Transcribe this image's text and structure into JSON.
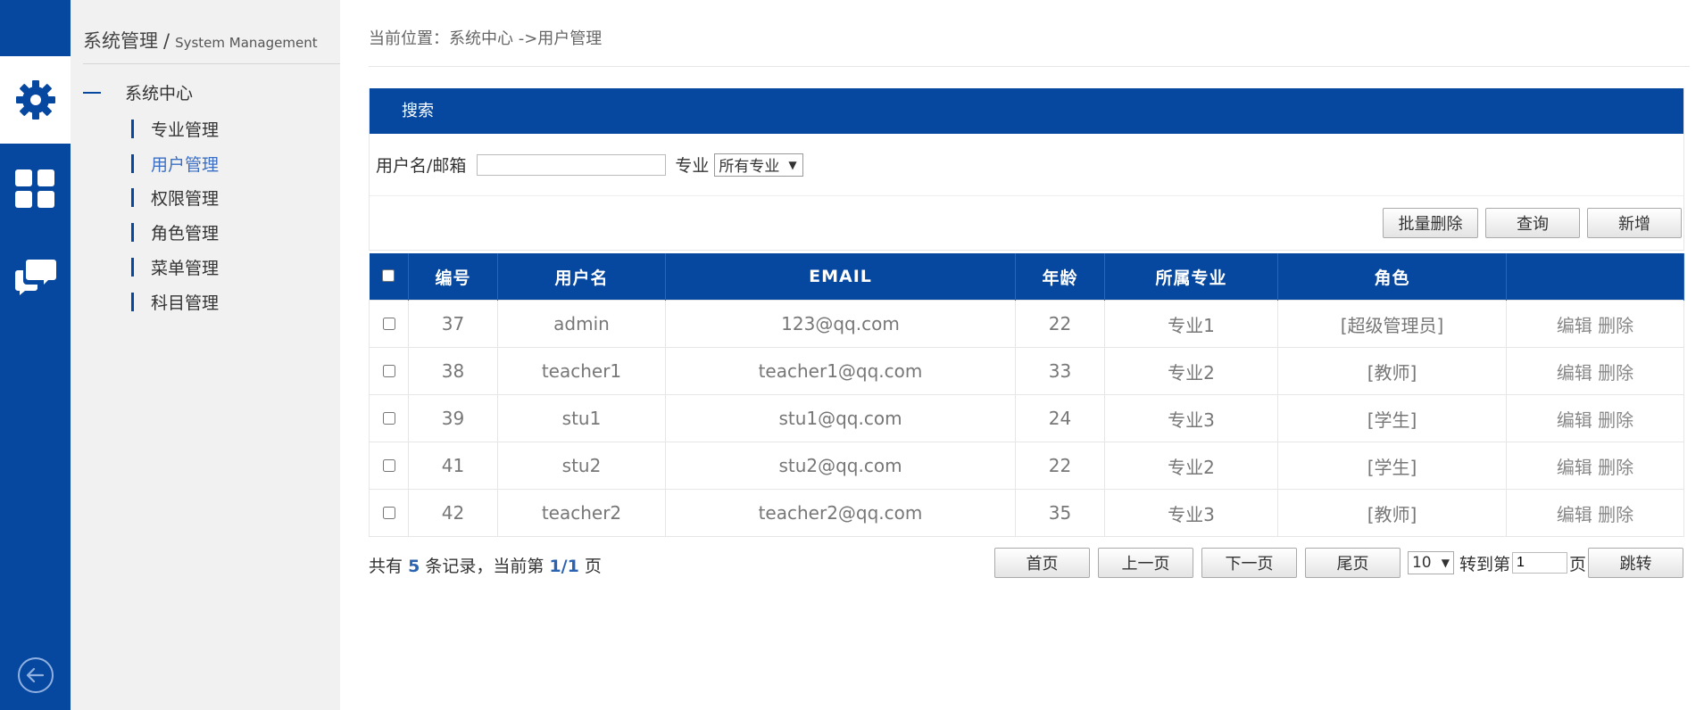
{
  "rail": {
    "items": [
      {
        "icon": "gear-icon",
        "active": true
      },
      {
        "icon": "grid-icon",
        "active": false
      },
      {
        "icon": "chat-icon",
        "active": false
      }
    ],
    "back_icon": "arrow-left-circle-icon"
  },
  "sidebar": {
    "title": "系统管理",
    "title_sep": "/",
    "title_en": "System Management",
    "group": "系统中心",
    "items": [
      {
        "label": "专业管理"
      },
      {
        "label": "用户管理",
        "active": true
      },
      {
        "label": "权限管理"
      },
      {
        "label": "角色管理"
      },
      {
        "label": "菜单管理"
      },
      {
        "label": "科目管理"
      }
    ]
  },
  "breadcrumb": "当前位置：系统中心 ->用户管理",
  "search": {
    "title": "搜索",
    "username_label": "用户名/邮箱",
    "username_value": "",
    "major_label": "专业",
    "major_selected": "所有专业"
  },
  "actions": {
    "batch_delete": "批量删除",
    "query": "查询",
    "add": "新增"
  },
  "table": {
    "headers": [
      "编号",
      "用户名",
      "EMAIL",
      "年龄",
      "所属专业",
      "角色",
      ""
    ],
    "rows": [
      {
        "id": "37",
        "username": "admin",
        "email": "123@qq.com",
        "age": "22",
        "major": "专业1",
        "role": "[超级管理员]"
      },
      {
        "id": "38",
        "username": "teacher1",
        "email": "teacher1@qq.com",
        "age": "33",
        "major": "专业2",
        "role": "[教师]"
      },
      {
        "id": "39",
        "username": "stu1",
        "email": "stu1@qq.com",
        "age": "24",
        "major": "专业3",
        "role": "[学生]"
      },
      {
        "id": "41",
        "username": "stu2",
        "email": "stu2@qq.com",
        "age": "22",
        "major": "专业2",
        "role": "[学生]"
      },
      {
        "id": "42",
        "username": "teacher2",
        "email": "teacher2@qq.com",
        "age": "35",
        "major": "专业3",
        "role": "[教师]"
      }
    ],
    "edit_label": "编辑",
    "delete_label": "删除"
  },
  "pagination": {
    "summary_prefix": "共有",
    "total": "5",
    "summary_mid": "条记录，当前第",
    "current": "1/1",
    "summary_suffix": "页",
    "first": "首页",
    "prev": "上一页",
    "next": "下一页",
    "last": "尾页",
    "page_size": "10",
    "goto_label": "转到第",
    "goto_value": "1",
    "goto_suffix": "页",
    "jump": "跳转"
  },
  "colors": {
    "primary": "#0648a0",
    "active_link": "#3a6fc4",
    "sidebar_bg": "#f1f1f1"
  }
}
